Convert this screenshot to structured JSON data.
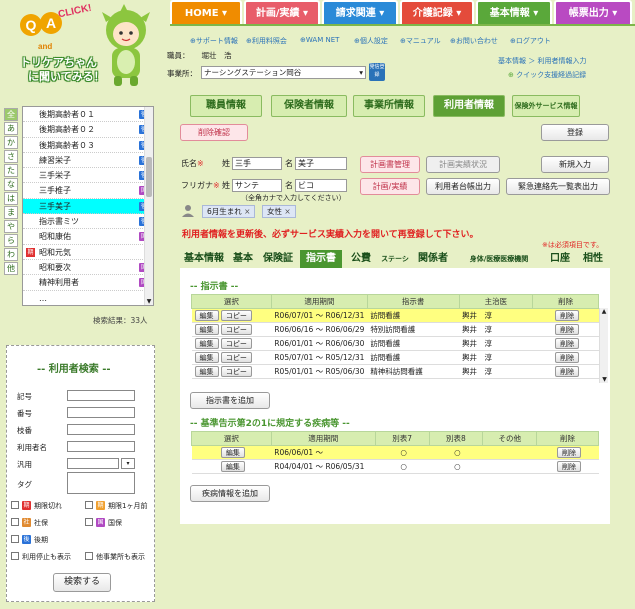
{
  "logo": {
    "qa_q": "Q",
    "qa_a": "A",
    "click": "CLICK!",
    "and": "and",
    "line1": "トリケアちゃん",
    "line2": "に聞いてみる！"
  },
  "nav": [
    {
      "label": "HOME",
      "color": "#f08c00"
    },
    {
      "label": "計画/実績",
      "color": "#e85d6a"
    },
    {
      "label": "請求関連",
      "color": "#2a8ad8"
    },
    {
      "label": "介護記録",
      "color": "#e44b3b"
    },
    {
      "label": "基本情報",
      "color": "#5aa83a"
    },
    {
      "label": "帳票出力",
      "color": "#b94ac2"
    }
  ],
  "links": [
    "サポート情報",
    "利用料照会",
    "WAM NET",
    "個人設定",
    "マニュアル",
    "お問い合わせ",
    "ログアウト"
  ],
  "staff": {
    "label": "職員：",
    "name": "堀壮　浩"
  },
  "office": {
    "label": "事業所：",
    "value": "ナーシングステーション岡谷",
    "badge": "発信登録"
  },
  "breadcrumb": "基本情報 ＞ 利用者情報入力",
  "quick_link": "クイック支援経過記録",
  "main_tabs": [
    "職員情報",
    "保険者情報",
    "事業所情報",
    "利用者情報",
    "保険外サービス情報"
  ],
  "buttons": {
    "delete_confirm": "削除確認",
    "register": "登録",
    "plan_manage": "計画書管理",
    "plan_status": "計画実績状況",
    "new_entry": "新規入力",
    "plan_result": "計画/実績",
    "ledger_output": "利用者台帳出力",
    "emergency_list": "緊急連絡先一覧表出力",
    "add_instruction": "指示書を追加",
    "add_disease": "疾病情報を追加",
    "search": "検索する"
  },
  "name_form": {
    "name_label": "氏名",
    "furigana_label": "フリガナ",
    "mark": "※",
    "sei": "姓",
    "mei": "名",
    "sei_val": "三手",
    "mei_val": "美子",
    "sei_kana": "サンテ",
    "mei_kana": "ビコ",
    "hint": "（全角カナで入力してください）"
  },
  "tags": [
    "6月生まれ",
    "女性"
  ],
  "warning": "利用者情報を更新後、必ずサービス実績入力を開いて再登録して下さい。",
  "required_note": "※は必須項目です。",
  "sub_tabs": [
    "基本情報",
    "基本",
    "保険証",
    "指示書",
    "公費",
    "ステーション",
    "関係者",
    "身体/医療医療機関",
    "口座",
    "相性"
  ],
  "instruction": {
    "title": "-- 指示書 --",
    "headers": [
      "選択",
      "適用期間",
      "指示書",
      "主治医",
      "削除"
    ],
    "edit": "編集",
    "copy": "コピー",
    "del": "削除",
    "rows": [
      {
        "from": "R06/07/01",
        "to": "R06/12/31",
        "type": "訪問看護",
        "doctor": "輿井　淳"
      },
      {
        "from": "R06/06/16",
        "to": "R06/06/29",
        "type": "特別訪問看護",
        "doctor": "輿井　淳"
      },
      {
        "from": "R06/01/01",
        "to": "R06/06/30",
        "type": "訪問看護",
        "doctor": "輿井　淳"
      },
      {
        "from": "R05/07/01",
        "to": "R05/12/31",
        "type": "訪問看護",
        "doctor": "輿井　淳"
      },
      {
        "from": "R05/01/01",
        "to": "R05/06/30",
        "type": "精神科訪問看護",
        "doctor": "輿井　淳"
      }
    ]
  },
  "disease": {
    "title": "-- 基準告示第2の1に規定する疾病等 --",
    "headers": [
      "選択",
      "適用期間",
      "別表7",
      "別表8",
      "その他",
      "削除"
    ],
    "rows": [
      {
        "from": "R06/06/01",
        "to": "",
        "b7": "○",
        "b8": "○"
      },
      {
        "from": "R04/04/01",
        "to": "R06/05/31",
        "b7": "○",
        "b8": "○"
      }
    ]
  },
  "kana": [
    "全",
    "あ",
    "か",
    "さ",
    "た",
    "な",
    "は",
    "ま",
    "や",
    "ら",
    "わ",
    "他"
  ],
  "users": [
    {
      "name": "後期高齢者０１",
      "badge": "後",
      "color": "#2a72d8"
    },
    {
      "name": "後期高齢者０２",
      "badge": "後",
      "color": "#2a72d8"
    },
    {
      "name": "後期高齢者０３",
      "badge": "後",
      "color": "#2a72d8"
    },
    {
      "name": "練習栄子",
      "badge": "後",
      "color": "#2a72d8"
    },
    {
      "name": "三手栄子",
      "badge": "後",
      "color": "#2a72d8"
    },
    {
      "name": "三手椎子",
      "badge": "国",
      "color": "#b04ac2"
    },
    {
      "name": "三手美子",
      "badge": "後",
      "color": "#2a72d8"
    },
    {
      "name": "指示書ミツ",
      "badge": "後",
      "color": "#2a72d8"
    },
    {
      "name": "昭和康佑",
      "badge": "国",
      "color": "#b04ac2"
    },
    {
      "name": "昭和元気",
      "badge": "",
      "color": ""
    },
    {
      "name": "昭和要次",
      "badge": "国",
      "color": "#b04ac2"
    },
    {
      "name": "精神利用者",
      "badge": "国",
      "color": "#b04ac2"
    },
    {
      "name": "…",
      "badge": "",
      "color": ""
    }
  ],
  "result_count": "検索結果：33人",
  "search": {
    "title": "-- 利用者検索 --",
    "fields": [
      "記号",
      "番号",
      "枝番",
      "利用者名",
      "汎用"
    ],
    "tag": "タグ",
    "chk1": "期限切れ",
    "chk2": "期限1ヶ月前",
    "chk3": "社保",
    "chk4": "国保",
    "chk5": "後期",
    "chk6": "利用停止も表示",
    "chk7": "他事業所も表示"
  }
}
